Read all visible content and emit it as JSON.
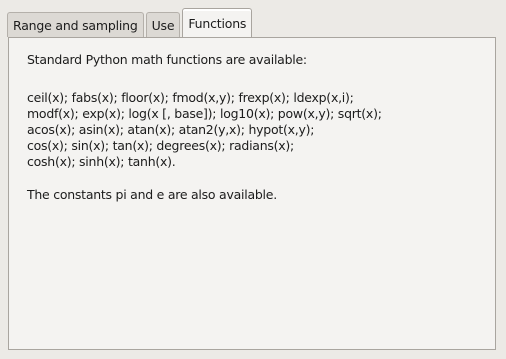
{
  "tabs": [
    {
      "label": "Range and sampling"
    },
    {
      "label": "Use"
    },
    {
      "label": "Functions"
    }
  ],
  "active_tab": "Functions",
  "panel": {
    "intro": "Standard Python math functions are available:",
    "functions_lines": [
      "ceil(x); fabs(x); floor(x); fmod(x,y); frexp(x); ldexp(x,i);",
      "modf(x); exp(x); log(x [, base]); log10(x); pow(x,y); sqrt(x);",
      "acos(x); asin(x); atan(x); atan2(y,x); hypot(x,y);",
      "cos(x); sin(x); tan(x); degrees(x); radians(x);",
      "cosh(x); sinh(x); tanh(x)."
    ],
    "constants_note": "The constants pi and e are also available."
  }
}
